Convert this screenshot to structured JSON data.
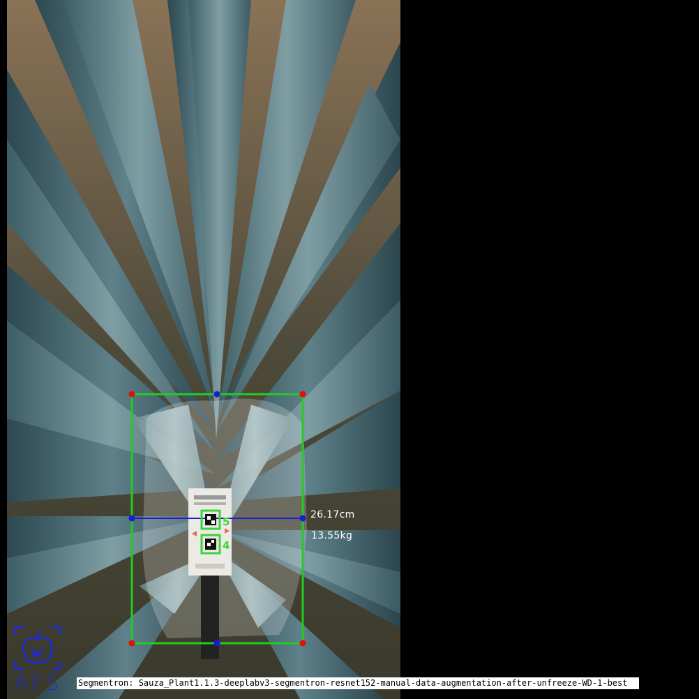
{
  "measurements": {
    "width": "26.17cm",
    "weight": "13.55kg"
  },
  "markers": [
    "5",
    "4"
  ],
  "logo": {
    "text": "AFS",
    "icon": "apple-icon"
  },
  "footer": {
    "label": "Segmentron: Sauza_Plant1.1.3-deeplabv3-segmentron-resnet152-manual-data-augmentation-after-unfreeze-WD-1-best"
  },
  "colors": {
    "box": "#22cc22",
    "corner": "#e01010",
    "midpoint": "#1a1ad8",
    "logo": "#1f2cc8"
  }
}
